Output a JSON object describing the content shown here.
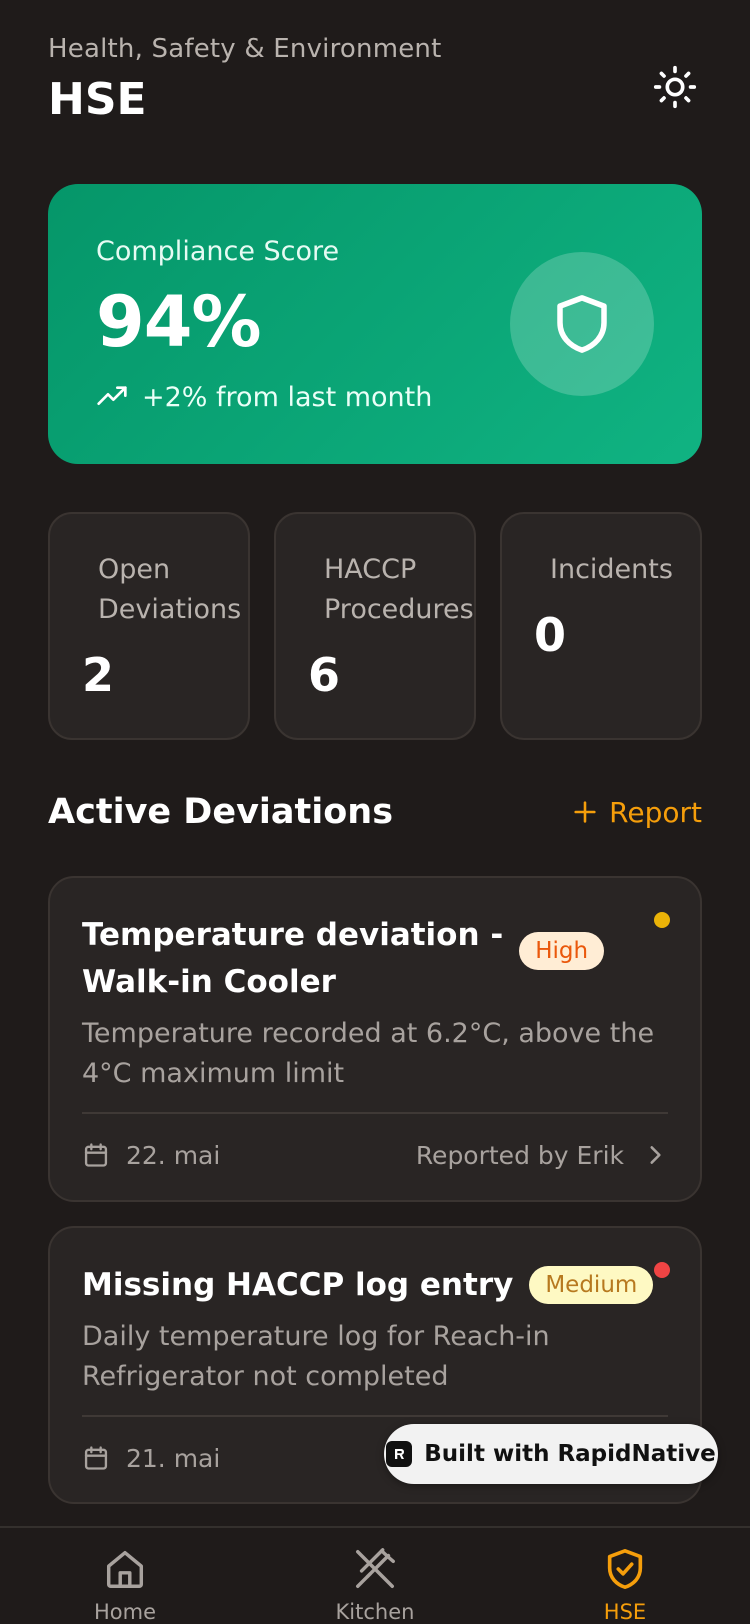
{
  "header": {
    "subtitle": "Health, Safety & Environment",
    "title": "HSE",
    "theme_icon": "sun-icon"
  },
  "compliance": {
    "label": "Compliance Score",
    "score": "94%",
    "trend": "+2% from last month",
    "trend_icon": "trending-up-icon",
    "badge_icon": "shield-icon"
  },
  "stats": [
    {
      "label": "Open Deviations",
      "value": "2"
    },
    {
      "label": "HACCP Procedures",
      "value": "6"
    },
    {
      "label": "Incidents",
      "value": "0"
    }
  ],
  "section": {
    "title": "Active Deviations",
    "report_label": "Report"
  },
  "deviations": [
    {
      "title_line1": "Temperature deviation -",
      "title_line2": "Walk-in Cooler",
      "severity": "High",
      "dot_color": "#eab308",
      "description": "Temperature recorded at 6.2°C, above the 4°C maximum limit",
      "date": "22. mai",
      "reporter": "Reported by Erik"
    },
    {
      "title_line1": "Missing HACCP log entry",
      "severity": "Medium",
      "dot_color": "#ef4444",
      "description": "Daily temperature log for Reach-in Refrigerator not completed",
      "date": "21. mai"
    }
  ],
  "branding": {
    "built_with": "Built with RapidNative"
  },
  "nav": {
    "items": [
      {
        "label": "Home",
        "icon": "home-icon"
      },
      {
        "label": "Kitchen",
        "icon": "utensils-icon"
      },
      {
        "label": "HSE",
        "icon": "shield-check-icon"
      }
    ],
    "active": "HSE"
  },
  "colors": {
    "background": "#1f1b1a",
    "card": "#292524",
    "accent": "#f59e0b",
    "green": "#10b382"
  }
}
